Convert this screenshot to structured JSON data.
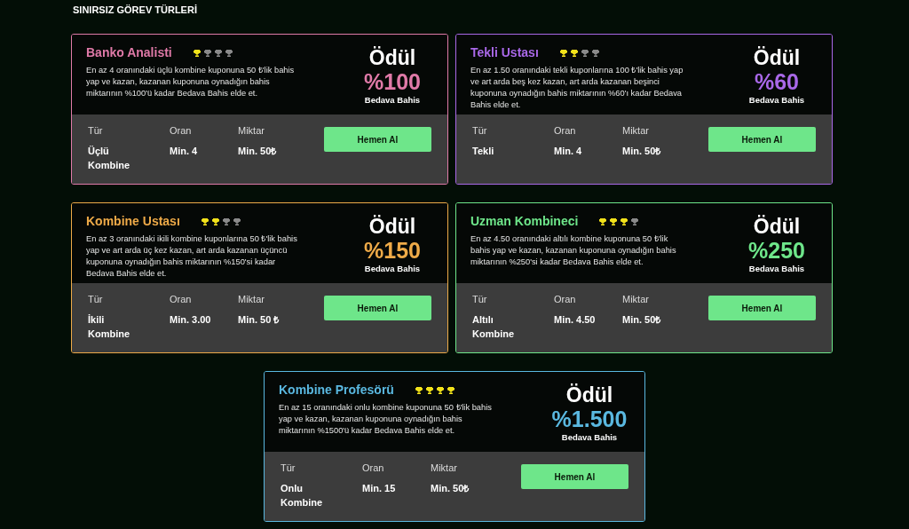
{
  "heading": "SINIRSIZ GÖREV TÜRLERİ",
  "cards": [
    {
      "title": "Banko Analisti",
      "color": "#e07aa8",
      "stars": 1,
      "description": "En az 4 oranındaki üçlü kombine kuponuna 50 ₺'lik bahis yap ve kazan, kazanan kuponuna oynadığın bahis miktarının %100'ü kadar Bedava Bahis elde et.",
      "reward_label": "Ödül",
      "reward": "%100",
      "reward_type": "Bedava Bahis",
      "fields": [
        {
          "label": "Tür",
          "value": "Üçlü Kombine"
        },
        {
          "label": "Oran",
          "value": "Min. 4"
        },
        {
          "label": "Miktar",
          "value": "Min. 50₺"
        }
      ],
      "button": "Hemen Al"
    },
    {
      "title": "Tekli Ustası",
      "color": "#a968e8",
      "stars": 2,
      "description": "En az 1.50 oranındaki tekli kuponlarına 100 ₺'lik bahis yap ve art arda beş kez kazan, art arda kazanan beşinci kuponuna oynadığın bahis miktarının %60'ı kadar Bedava Bahis elde et.",
      "reward_label": "Ödül",
      "reward": "%60",
      "reward_type": "Bedava Bahis",
      "fields": [
        {
          "label": "Tür",
          "value": "Tekli"
        },
        {
          "label": "Oran",
          "value": "Min. 4"
        },
        {
          "label": "Miktar",
          "value": "Min. 50₺"
        }
      ],
      "button": "Hemen Al"
    },
    {
      "title": "Kombine Ustası",
      "color": "#eeaa48",
      "stars": 2,
      "description": "En az 3 oranındaki ikili kombine kuponlarına 50 ₺'lik bahis yap ve art arda üç kez kazan, art arda kazanan üçüncü kuponuna oynadığın bahis miktarının %150'si kadar Bedava Bahis elde et.",
      "reward_label": "Ödül",
      "reward": "%150",
      "reward_type": "Bedava Bahis",
      "fields": [
        {
          "label": "Tür",
          "value": "İkili Kombine"
        },
        {
          "label": "Oran",
          "value": "Min. 3.00"
        },
        {
          "label": "Miktar",
          "value": "Min. 50 ₺"
        }
      ],
      "button": "Hemen Al"
    },
    {
      "title": "Uzman Kombineci",
      "color": "#6ee68a",
      "stars": 3,
      "description": "En az 4.50 oranındaki altılı kombine kuponuna 50 ₺'lik bahis yap ve kazan, kazanan kuponuna oynadığın bahis miktarının %250'si kadar Bedava Bahis elde et.",
      "reward_label": "Ödül",
      "reward": "%250",
      "reward_type": "Bedava Bahis",
      "fields": [
        {
          "label": "Tür",
          "value": "Altılı Kombine"
        },
        {
          "label": "Oran",
          "value": "Min. 4.50"
        },
        {
          "label": "Miktar",
          "value": "Min. 50₺"
        }
      ],
      "button": "Hemen Al"
    },
    {
      "title": "Kombine Profesörü",
      "color": "#5ab8e0",
      "stars": 4,
      "description": "En az 15 oranındaki onlu kombine kuponuna 50 ₺'lik bahis yap ve kazan, kazanan kuponuna oynadığın bahis miktarının %1500'ü kadar Bedava Bahis elde et.",
      "reward_label": "Ödül",
      "reward": "%1.500",
      "reward_type": "Bedava Bahis",
      "fields": [
        {
          "label": "Tür",
          "value": "Onlu Kombine"
        },
        {
          "label": "Oran",
          "value": "Min. 15"
        },
        {
          "label": "Miktar",
          "value": "Min. 50₺"
        }
      ],
      "button": "Hemen Al"
    }
  ]
}
